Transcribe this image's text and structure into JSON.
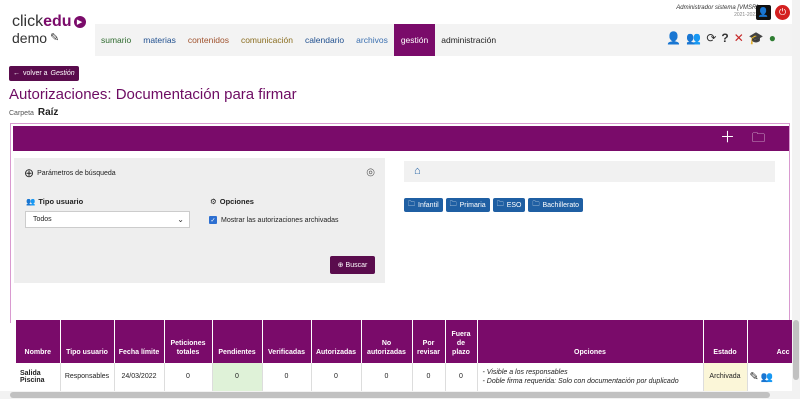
{
  "logo": {
    "brand": "click",
    "brand_bold": "edu",
    "sub": "demo"
  },
  "user": {
    "name": "Administrador sistema [VMSR]",
    "year": "2021-2022"
  },
  "nav": {
    "items": [
      {
        "label": "sumario",
        "color": "#2f6b2f"
      },
      {
        "label": "materias",
        "color": "#1f4f8f"
      },
      {
        "label": "contenidos",
        "color": "#a0522d"
      },
      {
        "label": "comunicación",
        "color": "#8a6d1f"
      },
      {
        "label": "calendario",
        "color": "#1f4f8f"
      },
      {
        "label": "archivos",
        "color": "#3a6fb0"
      },
      {
        "label": "gestión",
        "color": "#ffffff"
      },
      {
        "label": "administración",
        "color": "#222222"
      }
    ],
    "active": "gestión"
  },
  "back": {
    "label": "volver a",
    "target": "Gestión"
  },
  "page": {
    "title": "Autorizaciones: Documentación para firmar",
    "crumb_label": "Carpeta",
    "crumb_value": "Raíz"
  },
  "search": {
    "title": "Parámetros de búsqueda",
    "tipo_label": "Tipo usuario",
    "tipo_value": "Todos",
    "opciones_label": "Opciones",
    "checkbox_label": "Mostrar las autorizaciones archivadas",
    "button": "Buscar"
  },
  "folders": [
    "Infantil",
    "Primaria",
    "ESO",
    "Bachillerato"
  ],
  "table": {
    "headers": [
      "Nombre",
      "Tipo usuario",
      "Fecha límite",
      "Peticiones totales",
      "Pendientes",
      "Verificadas",
      "Autorizadas",
      "No autorizadas",
      "Por revisar",
      "Fuera de plazo",
      "Opciones",
      "Estado",
      "Acc"
    ],
    "rows": [
      {
        "nombre": "Salida Piscina",
        "tipo": "Responsables",
        "fecha": "24/03/2022",
        "totales": "0",
        "pendientes": "0",
        "verificadas": "0",
        "autorizadas": "0",
        "no_autorizadas": "0",
        "por_revisar": "0",
        "fuera": "0",
        "opcion1": "- Visible a los responsables",
        "opcion2": "- Doble firma requerida: Solo con documentación por duplicado",
        "estado": "Archivada"
      }
    ]
  },
  "colors": {
    "brand": "#7a0b6a",
    "folder": "#1f5fa3"
  }
}
